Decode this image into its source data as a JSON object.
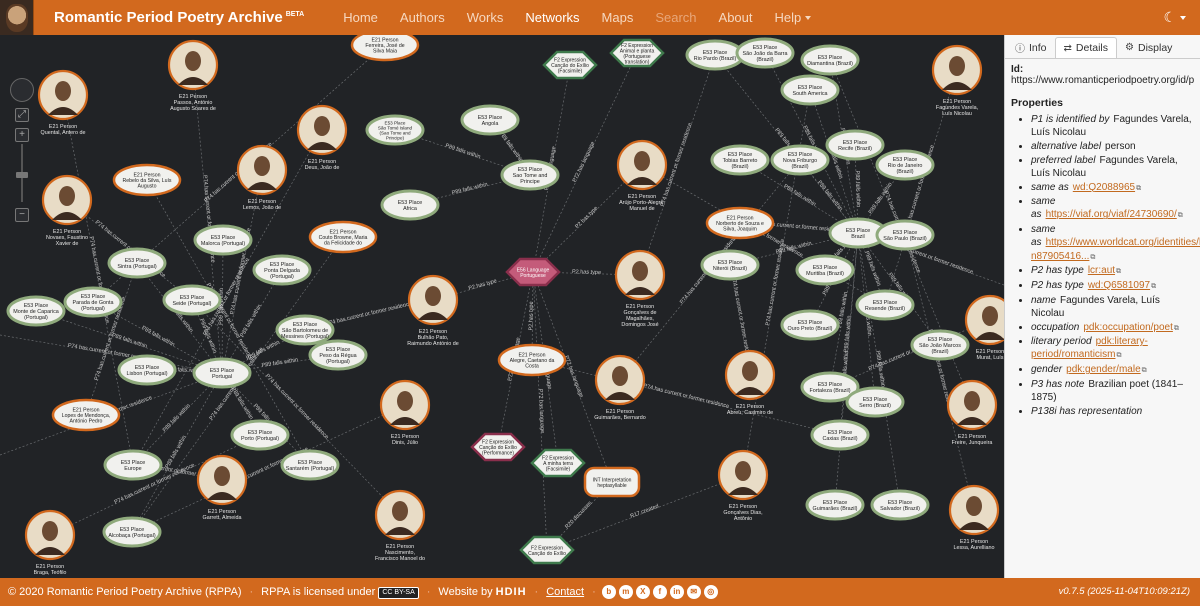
{
  "navbar": {
    "brand": "Romantic Period Poetry Archive",
    "brand_badge": "BETA",
    "items": [
      {
        "label": "Home",
        "state": "normal"
      },
      {
        "label": "Authors",
        "state": "normal"
      },
      {
        "label": "Works",
        "state": "normal"
      },
      {
        "label": "Networks",
        "state": "active"
      },
      {
        "label": "Maps",
        "state": "normal"
      },
      {
        "label": "Search",
        "state": "disabled"
      },
      {
        "label": "About",
        "state": "normal"
      },
      {
        "label": "Help",
        "state": "normal"
      }
    ],
    "theme_icon": "moon-icon"
  },
  "panel": {
    "tabs": [
      {
        "label": "Info",
        "icon": "info-icon"
      },
      {
        "label": "Details",
        "icon": "swap-icon"
      },
      {
        "label": "Display",
        "icon": "gear-icon"
      }
    ],
    "active_tab": "Details",
    "id_label": "Id:",
    "id_value": "https://www.romanticperiodpoetry.org/id/pers",
    "properties_title": "Properties",
    "properties": [
      {
        "key": "P1 is identified by",
        "value": "Fagundes Varela, Luís Nicolau",
        "link": false
      },
      {
        "key": "alternative label",
        "value": "person",
        "link": false
      },
      {
        "key": "preferred label",
        "value": "Fagundes Varela, Luís Nicolau",
        "link": false
      },
      {
        "key": "same as",
        "value": "wd:Q2088965",
        "link": true
      },
      {
        "key": "same as",
        "value": "https://viaf.org/viaf/24730690/",
        "link": true
      },
      {
        "key": "same as",
        "value": "https://www.worldcat.org/identities/lccn-n87905416...",
        "link": true
      },
      {
        "key": "P2 has type",
        "value": "lcr:aut",
        "link": true
      },
      {
        "key": "P2 has type",
        "value": "wd:Q6581097",
        "link": true
      },
      {
        "key": "name",
        "value": "Fagundes Varela, Luís Nicolau",
        "link": false
      },
      {
        "key": "occupation",
        "value": "pdk:occupation/poet",
        "link": true
      },
      {
        "key": "literary period",
        "value": "pdk:literary-period/romanticism",
        "link": true
      },
      {
        "key": "gender",
        "value": "pdk:gender/male",
        "link": true
      },
      {
        "key": "P3 has note",
        "value": "Brazilian poet (1841–1875)",
        "link": false
      },
      {
        "key": "P138i has representation",
        "value": "",
        "link": false
      }
    ]
  },
  "graph": {
    "places": [
      {
        "label": "E53 Place\nAngola"
      },
      {
        "label": "E53 Place\nSão Tomé Island\n(Sao Tome and\nPrincipe)"
      },
      {
        "label": "E53 Place\nSao Tome and\nPrincipe"
      },
      {
        "label": "E53 Place\nAfrica"
      },
      {
        "label": "E53 Place\nRio Pardo (Brazil)"
      },
      {
        "label": "E53 Place\nSão João da Barra\n(Brazil)"
      },
      {
        "label": "E53 Place\nDiamantina (Brazil)"
      },
      {
        "label": "E53 Place\nSouth America"
      },
      {
        "label": "E53 Place\nTobias Barreto\n(Brazil)"
      },
      {
        "label": "E53 Place\nNova Friburgo\n(Brazil)"
      },
      {
        "label": "E53 Place\nRecife (Brazil)"
      },
      {
        "label": "E53 Place\nRio de Janeiro\n(Brazil)"
      },
      {
        "label": "E53 Place\nBrazil"
      },
      {
        "label": "E53 Place\nSão Paulo (Brazil)"
      },
      {
        "label": "E53 Place\nNiterói (Brazil)"
      },
      {
        "label": "E53 Place\nMuritiba (Brazil)"
      },
      {
        "label": "E53 Place\nResende (Brazil)"
      },
      {
        "label": "E53 Place\nOuro Preto (Brazil)"
      },
      {
        "label": "E53 Place\nSão João Marcos\n(Brazil)"
      },
      {
        "label": "E53 Place\nFortaleza (Brazil)"
      },
      {
        "label": "E53 Place\nSerro (Brazil)"
      },
      {
        "label": "E53 Place\nCaxias (Brazil)"
      },
      {
        "label": "E53 Place\nGuimarães (Brazil)"
      },
      {
        "label": "E53 Place\nSalvador (Brazil)"
      },
      {
        "label": "E53 Place\nMalorca (Portugal)"
      },
      {
        "label": "E53 Place\nPonta Delgada\n(Portugal)"
      },
      {
        "label": "E53 Place\nSintra (Portugal)"
      },
      {
        "label": "E53 Place\nParada de Gonta\n(Portugal)"
      },
      {
        "label": "E53 Place\nSeide (Portugal)"
      },
      {
        "label": "E53 Place\nMonte de Caparica\n(Portugal)"
      },
      {
        "label": "E53 Place\nSão Bartolomeu de\nMessines (Portugal)"
      },
      {
        "label": "E53 Place\nPeso da Régua\n(Portugal)"
      },
      {
        "label": "E53 Place\nLisbon (Portugal)"
      },
      {
        "label": "E53 Place\nPortugal"
      },
      {
        "label": "E53 Place\nPorto (Portugal)"
      },
      {
        "label": "E53 Place\nEurope"
      },
      {
        "label": "E53 Place\nSantarém (Portugal)"
      },
      {
        "label": "E53 Place\nAlcobaça (Portugal)"
      }
    ],
    "persons": [
      {
        "label": "E21 Person\nPassos, António\nAugusto Soares de"
      },
      {
        "label": "E21 Person\nQuental, Antero de"
      },
      {
        "label": "E21 Person\nDeus, João de"
      },
      {
        "label": "E21 Person\nLemos, João de"
      },
      {
        "label": "E21 Person\nNovaes, Faustino\nXavier de"
      },
      {
        "label": "E21 Person\nArújo Porto-Alegre,\nManuel de"
      },
      {
        "label": "E21 Person\nGonçalves de\nMagalhães,\nDomingos José"
      },
      {
        "label": "E21 Person\nBulhão Pato,\nRaimundo António de"
      },
      {
        "label": "E21 Person\nGuimarães, Bernardo"
      },
      {
        "label": "E21 Person\nAbreu, Casimiro de"
      },
      {
        "label": "E21 Person\nDinis, Júlio"
      },
      {
        "label": "E21 Person\nGarrett, Almeida"
      },
      {
        "label": "E21 Person\nNascimento,\nFrancisco Manoel do"
      },
      {
        "label": "E21 Person\nGonçalves Dias,\nAntônio"
      },
      {
        "label": "E21 Person\nBraga, Teófilo"
      },
      {
        "label": "E21 Person\nFagundes Varela,\nLuís Nicolau"
      },
      {
        "label": "E21 Person\nFreire, Junqueira"
      },
      {
        "label": "E21 Person\nLessa, Aurelliano"
      },
      {
        "label": "E21 Person\nMurat, Luís"
      },
      {
        "label": "E21 Person\nFerreira, José de\nSilva Maia"
      },
      {
        "label": "E21 Person\nRebelo da Silva, Luís\nAugusto"
      },
      {
        "label": "E21 Person\nCouto Browne, Maria\nda Felicidade do"
      },
      {
        "label": "E21 Person\nNorberto de Souza e\nSilva, Joaquim"
      },
      {
        "label": "E21 Person\nAlegre, Caetano da\nCosta"
      },
      {
        "label": "E21 Person\nLopes de Mendonça,\nAntónio Pedro"
      }
    ],
    "expressions": [
      {
        "label": "F2 Expression\nCanção do Exílio\n(Facsimile)"
      },
      {
        "label": "F2 Expression\nAnimal e planta\n(Portuguese\ntranslation)"
      },
      {
        "label": "E56 Language\nPortuguese"
      },
      {
        "label": "F2 Expression\nCanção do Exílio\n(Performance)"
      },
      {
        "label": "F2 Expression\nA minha terra\n(Facsimile)"
      },
      {
        "label": "INT Interpretation\nheptasyllable"
      },
      {
        "label": "F2 Expression\nCanção do Exílio"
      }
    ],
    "edge_labels": [
      "P74 has current or former residence",
      "P89 falls within",
      "P2 has type",
      "P72 has language",
      "P7 took place at",
      "R17 created",
      "R3 is realised in",
      "R20 discusses"
    ]
  },
  "footer": {
    "copyright": "© 2020 Romantic Period Poetry Archive (RPPA)",
    "license_text": "RPPA is licensed under",
    "license_badge": "CC BY-SA",
    "website_by": "Website by",
    "studio": "HDIH",
    "contact": "Contact",
    "social": [
      "bluesky-icon",
      "mastodon-icon",
      "x-icon",
      "facebook-icon",
      "linkedin-icon",
      "email-icon",
      "rss-icon"
    ],
    "version": "v0.7.5 (2025-11-04T10:09:21Z)"
  }
}
